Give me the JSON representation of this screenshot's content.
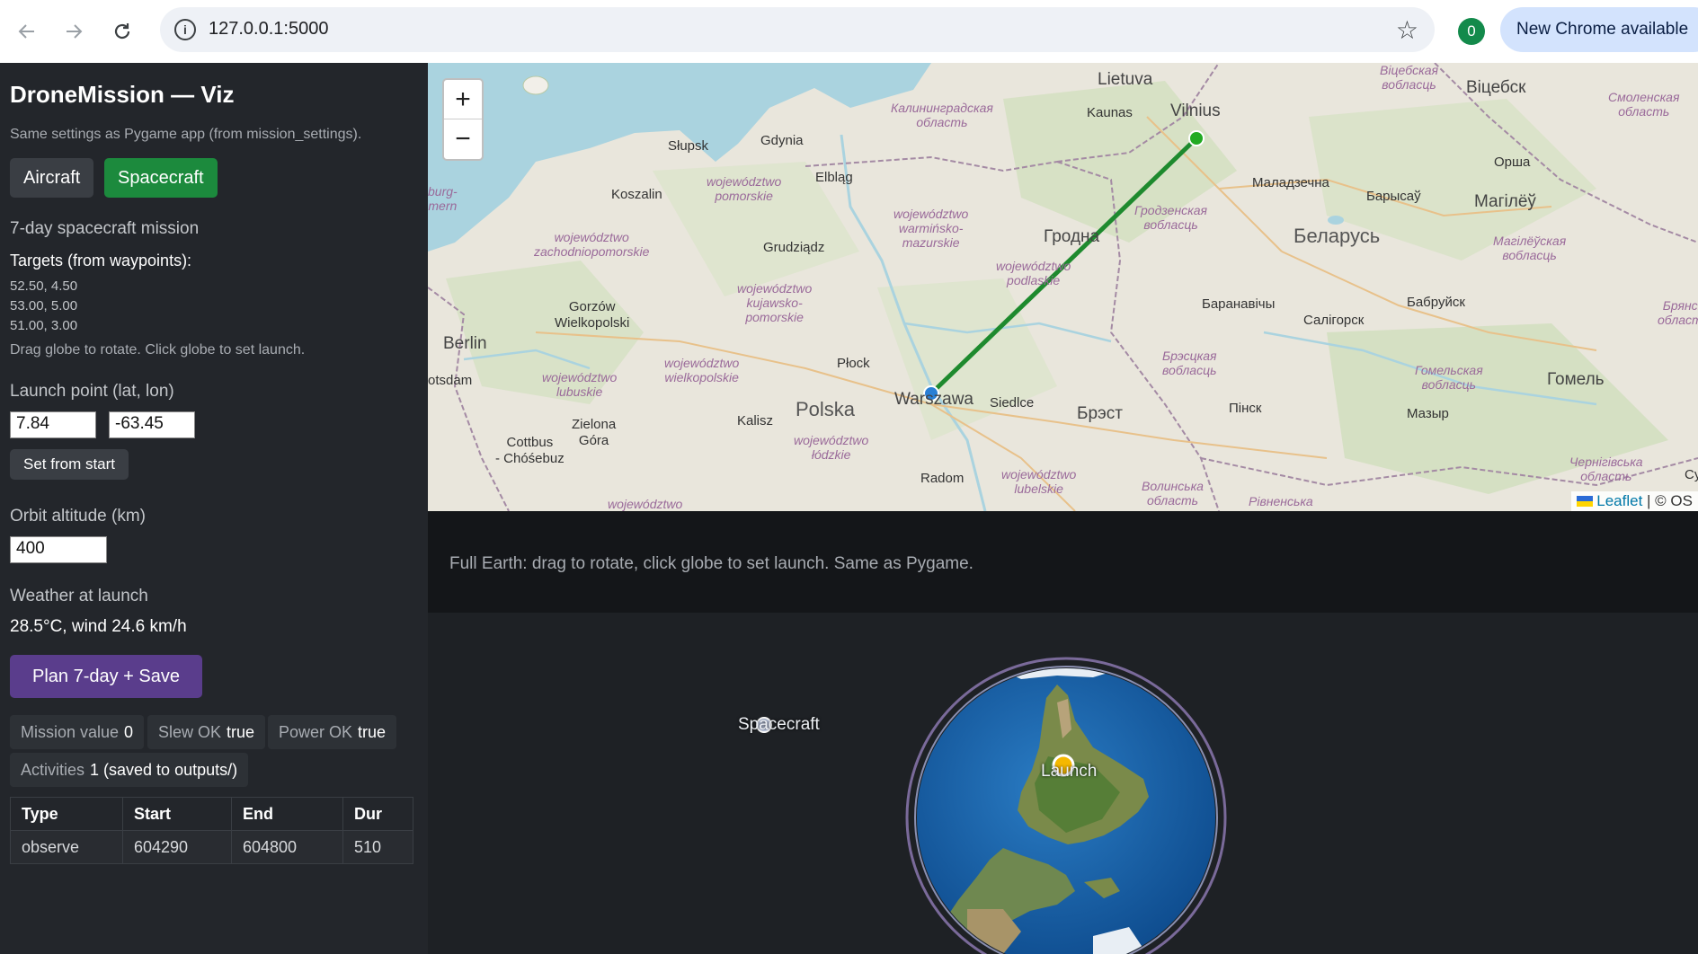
{
  "browser": {
    "url": "127.0.0.1:5000",
    "profile_initial": "0",
    "update_label": "New Chrome available",
    "icons": [
      "back-icon",
      "forward-icon",
      "reload-icon",
      "info-icon",
      "star-icon",
      "more-icon"
    ]
  },
  "sidebar": {
    "title": "DroneMission — Viz",
    "subtitle": "Same settings as Pygame app (from mission_settings).",
    "mode_aircraft": "Aircraft",
    "mode_spacecraft": "Spacecraft",
    "mission_heading": "7-day spacecraft mission",
    "targets_heading": "Targets (from waypoints):",
    "waypoints": [
      "52.50, 4.50",
      "53.00, 5.00",
      "51.00, 3.00"
    ],
    "hint": "Drag globe to rotate. Click globe to set launch.",
    "launch_heading": "Launch point (lat, lon)",
    "launch_lat": "7.84",
    "launch_lon": "-63.45",
    "set_from_start": "Set from start",
    "altitude_heading": "Orbit altitude (km)",
    "altitude_value": "400",
    "weather_heading": "Weather at launch",
    "weather_value": "28.5°C, wind 24.6 km/h",
    "plan_button": "Plan 7-day + Save",
    "stats": {
      "mission_value_label": "Mission value",
      "mission_value": "0",
      "slew_label": "Slew OK",
      "slew_value": "true",
      "power_label": "Power OK",
      "power_value": "true",
      "activities_label": "Activities",
      "activities_value": "1 (saved to outputs/)"
    },
    "table": {
      "headers": [
        "Type",
        "Start",
        "End",
        "Dur"
      ],
      "rows": [
        [
          "observe",
          "604290",
          "604800",
          "510"
        ]
      ]
    }
  },
  "map": {
    "zoom_in": "+",
    "zoom_out": "−",
    "attribution_link": "Leaflet",
    "attribution_rest": "| © OS",
    "route_color": "#1e8a2e",
    "start_marker_color": "#2a7fd4",
    "end_marker_color": "#22aa22",
    "labels": {
      "lietuva": "Lietuva",
      "vilnius": "Vilnius",
      "kaunas": "Kaunas",
      "vitebsk": "Віцебск",
      "smolensk": "Смоленская\nобласть",
      "orsha": "Орша",
      "mogilev": "Магілёў",
      "mogilev_obl": "Магілёўская\nвобласць",
      "vitebsk_obl": "Віцебская\nвобласць",
      "kalinin": "Калининградская\nобласть",
      "slupsk": "Słupsk",
      "gdynia": "Gdynia",
      "elblag": "Elbląg",
      "koszalin": "Koszalin",
      "pomorskie": "województwo\npomorskie",
      "zachodniopom": "województwo\nzachodniopomorskie",
      "grudziadz": "Grudziądz",
      "warminsko": "województwo\nwarmińsko-\nmazurskie",
      "grodno": "Гродна",
      "grodno_obl": "Гродзенская\nвобласць",
      "belarus": "Беларусь",
      "maladzechna": "Маладзечна",
      "barysau": "Барысаў",
      "gorzow": "Gorzów\nWielkopolski",
      "kujawsko": "województwo\nkujawsko-\npomorskie",
      "podlaskie": "województwo\npodlaskie",
      "baranavichy": "Баранавічы",
      "salihorsk": "Салігорск",
      "babruysk": "Бабруйск",
      "bryansk": "Брянск\nобласть",
      "berlin": "Berlin",
      "potsdam": "otsdam",
      "lubuskie": "województwo\nlubuskie",
      "wielkopolskie": "województwo\nwielkopolskie",
      "plock": "Płock",
      "polska": "Polska",
      "warszawa": "Warszawa",
      "siedlce": "Siedlce",
      "brest": "Брэст",
      "brest_obl": "Брэсцкая\nвобласць",
      "pinsk": "Пінск",
      "gomel_obl": "Гомельская\nвобласць",
      "gomel": "Гомель",
      "mazyr": "Мазыр",
      "zielona": "Zielona\nGóra",
      "kalisz": "Kalisz",
      "lodzkie": "województwo\nłódzkie",
      "cottbus": "Cottbus\n- Chóśebuz",
      "radom": "Radom",
      "lubelskie": "województwo\nlubelskie",
      "volyn": "Волинська\nобласть",
      "rivne": "Рівненська",
      "chernihiv": "Чернігівська\nобласть",
      "mecklenburg": "burg-\nmern",
      "woj_bottom": "województwo",
      "su": "Су"
    }
  },
  "globe": {
    "caption": "Full Earth: drag to rotate, click globe to set launch. Same as Pygame.",
    "spacecraft_label": "Spacecraft",
    "launch_label": "Launch",
    "ocean_color": "#1560a8",
    "launch_color": "#f5b800"
  }
}
